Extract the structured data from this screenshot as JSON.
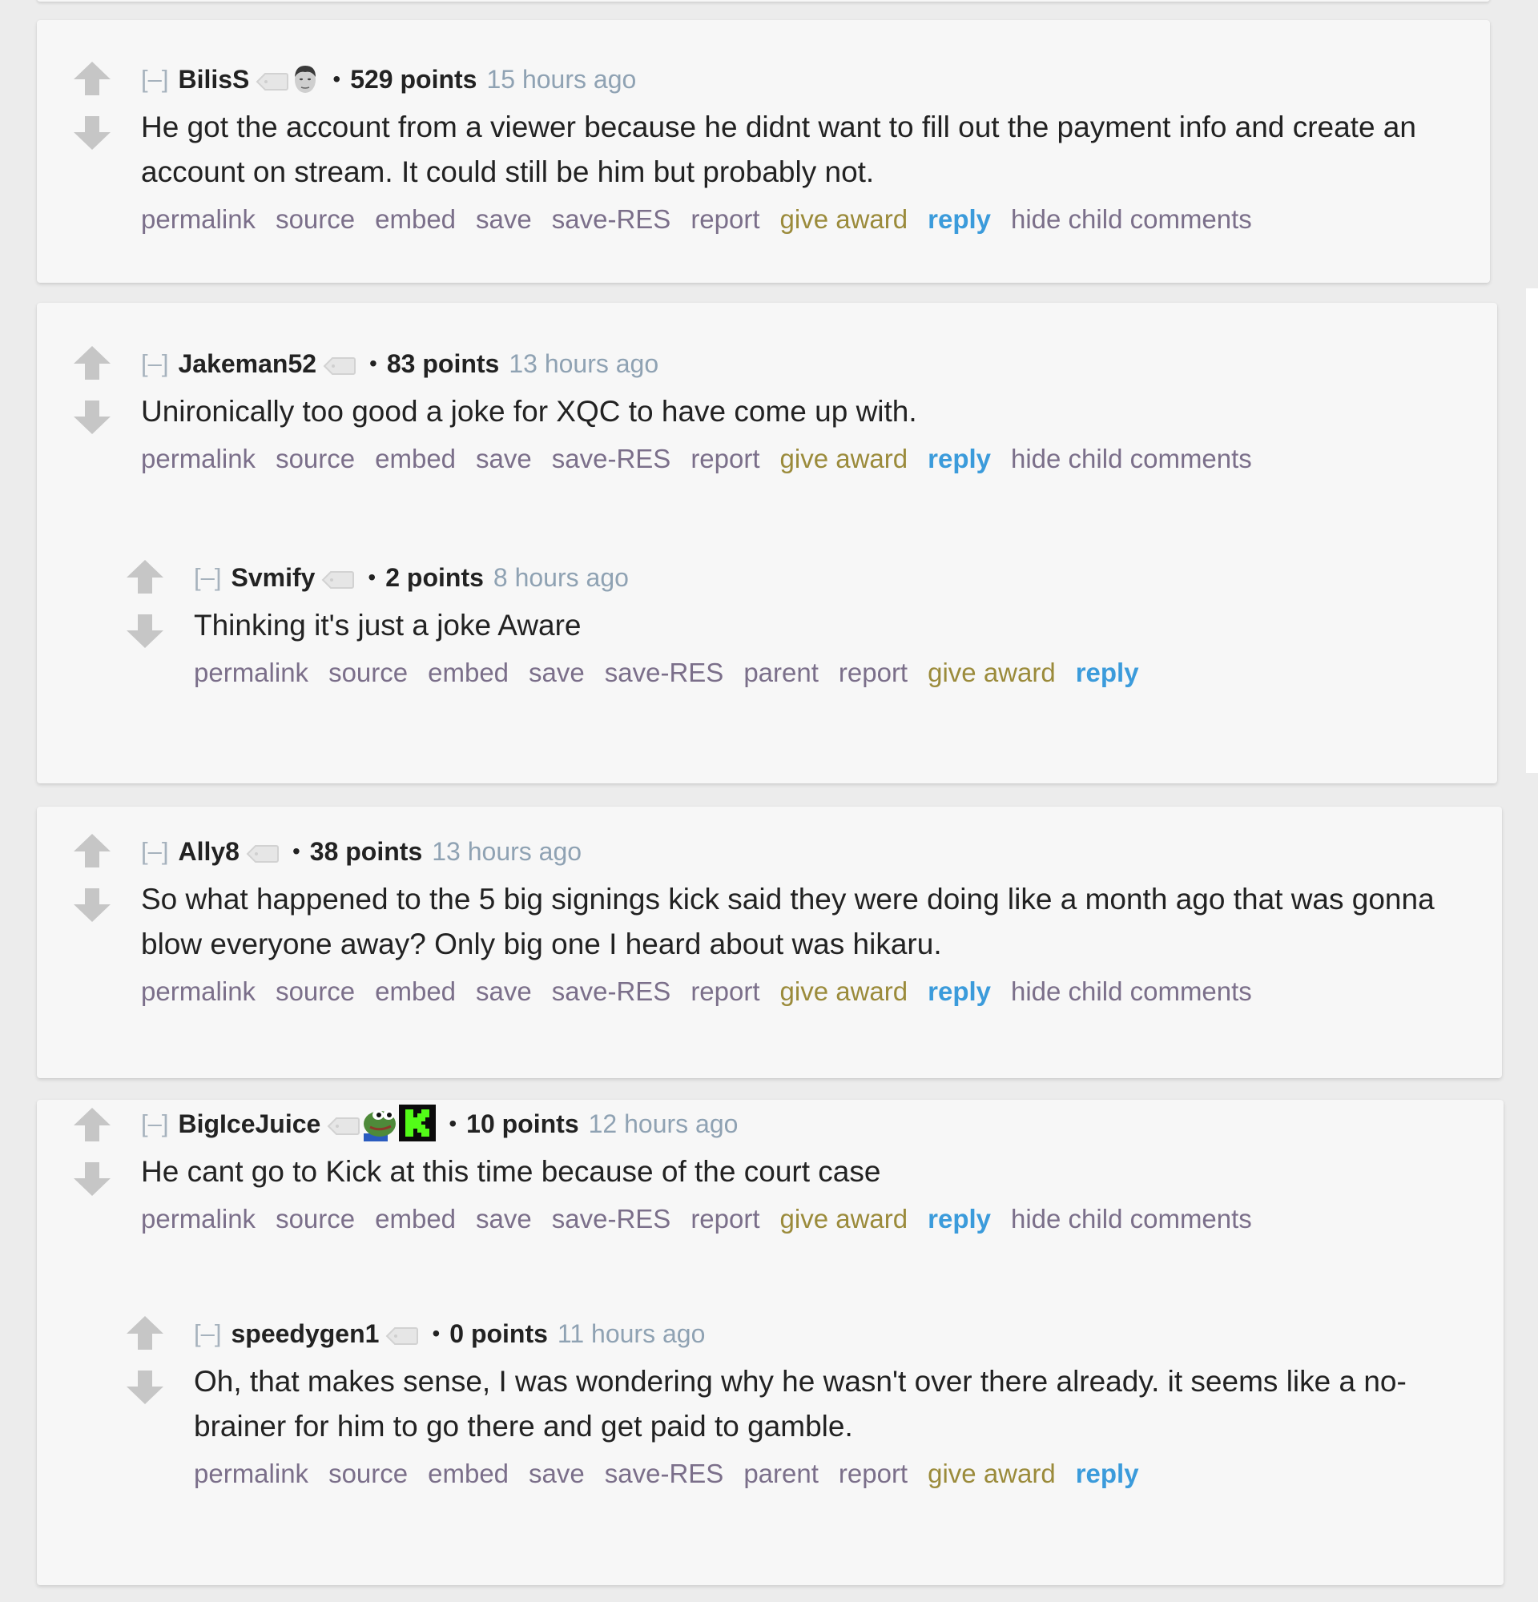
{
  "colors": {
    "background": "#ececec",
    "card": "#f7f7f7",
    "link": "#7b6f8a",
    "award": "#9b8b3b",
    "reply": "#3b9bdb",
    "timestamp": "#8fa2b3",
    "vote_arrow": "#c6c6c6"
  },
  "icons": {
    "upvote": "upvote-arrow-icon",
    "downvote": "downvote-arrow-icon",
    "user_tag": "tag-icon"
  },
  "comments": [
    {
      "collapse": "[–]",
      "author": "BilisS",
      "flair": [
        "kappa-face-emote"
      ],
      "bullet": "•",
      "points": "529 points",
      "time": "15 hours ago",
      "body": "He got the account from a viewer because he didnt want to fill out the payment info and create an account on stream. It could still be him but probably not.",
      "actions": [
        "permalink",
        "source",
        "embed",
        "save",
        "save-RES",
        "report",
        "give award",
        "reply",
        "hide child comments"
      ]
    },
    {
      "collapse": "[–]",
      "author": "Jakeman52",
      "flair": [],
      "bullet": "•",
      "points": "83 points",
      "time": "13 hours ago",
      "body": "Unironically too good a joke for XQC to have come up with.",
      "actions": [
        "permalink",
        "source",
        "embed",
        "save",
        "save-RES",
        "report",
        "give award",
        "reply",
        "hide child comments"
      ],
      "replies": [
        {
          "collapse": "[–]",
          "author": "Svmify",
          "flair": [],
          "bullet": "•",
          "points": "2 points",
          "time": "8 hours ago",
          "body": "Thinking it's just a joke Aware",
          "actions": [
            "permalink",
            "source",
            "embed",
            "save",
            "save-RES",
            "parent",
            "report",
            "give award",
            "reply"
          ]
        }
      ]
    },
    {
      "collapse": "[–]",
      "author": "Ally8",
      "flair": [],
      "bullet": "•",
      "points": "38 points",
      "time": "13 hours ago",
      "body": "So what happened to the 5 big signings kick said they were doing like a month ago that was gonna blow everyone away? Only big one I heard about was hikaru.",
      "actions": [
        "permalink",
        "source",
        "embed",
        "save",
        "save-RES",
        "report",
        "give award",
        "reply",
        "hide child comments"
      ]
    },
    {
      "collapse": "[–]",
      "author": "BigIceJuice",
      "flair": [
        "pepe-frog-emote",
        "kick-logo-emote"
      ],
      "bullet": "•",
      "points": "10 points",
      "time": "12 hours ago",
      "body": "He cant go to Kick at this time because of the court case",
      "actions": [
        "permalink",
        "source",
        "embed",
        "save",
        "save-RES",
        "report",
        "give award",
        "reply",
        "hide child comments"
      ],
      "replies": [
        {
          "collapse": "[–]",
          "author": "speedygen1",
          "flair": [],
          "bullet": "•",
          "points": "0 points",
          "time": "11 hours ago",
          "body": "Oh, that makes sense, I was wondering why he wasn't over there already. it seems like a no-brainer for him to go there and get paid to gamble.",
          "actions": [
            "permalink",
            "source",
            "embed",
            "save",
            "save-RES",
            "parent",
            "report",
            "give award",
            "reply"
          ]
        }
      ]
    }
  ]
}
